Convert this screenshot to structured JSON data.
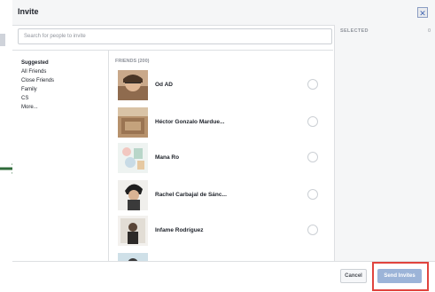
{
  "dialog": {
    "title": "Invite",
    "close_icon": "close-icon"
  },
  "search": {
    "placeholder": "Search for people to invite"
  },
  "selected": {
    "label": "SELECTED",
    "count": "0"
  },
  "categories": [
    {
      "label": "Suggested",
      "active": true
    },
    {
      "label": "All Friends",
      "active": false
    },
    {
      "label": "Close Friends",
      "active": false
    },
    {
      "label": "Family",
      "active": false
    },
    {
      "label": "CS",
      "active": false
    },
    {
      "label": "More...",
      "active": false
    }
  ],
  "friends": {
    "heading": "FRIENDS (200)",
    "items": [
      {
        "name": "Od AD"
      },
      {
        "name": "Héctor Gonzalo Mardue..."
      },
      {
        "name": "Mana Ro"
      },
      {
        "name": "Rachel Carbajal de Sánc..."
      },
      {
        "name": "Infame Rodríguez"
      }
    ]
  },
  "footer": {
    "cancel_label": "Cancel",
    "send_label": "Send Invites"
  },
  "colors": {
    "accent": "#4267b2",
    "send_disabled": "#9cb4d8",
    "highlight": "#e0443e"
  }
}
